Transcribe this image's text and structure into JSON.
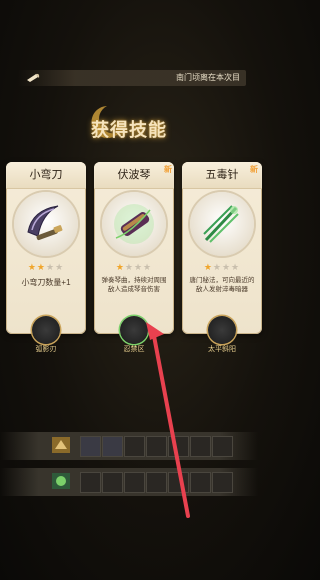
{
  "topbar": {
    "ticker": "南门顷离在本次目"
  },
  "title": "获得技能",
  "cards": [
    {
      "name": "小弯刀",
      "stars_on": 2,
      "stars_total": 4,
      "desc": "小弯刀数量+1",
      "new": false,
      "skill_label": "弧影刃"
    },
    {
      "name": "伏波琴",
      "stars_on": 1,
      "stars_total": 4,
      "desc": "弹奏琴曲，持续对周围敌人造成琴音伤害",
      "new": true,
      "skill_label": "忍禁区"
    },
    {
      "name": "五毒针",
      "stars_on": 1,
      "stars_total": 4,
      "desc": "唐门秘法，可向最近的敌人发射淬毒暗器",
      "new": true,
      "skill_label": "太平斜阳"
    }
  ],
  "new_tag": "新",
  "colors": {
    "accent": "#f0a52a",
    "title_glow": "#c79a3c",
    "arrow": "#e8414f"
  }
}
